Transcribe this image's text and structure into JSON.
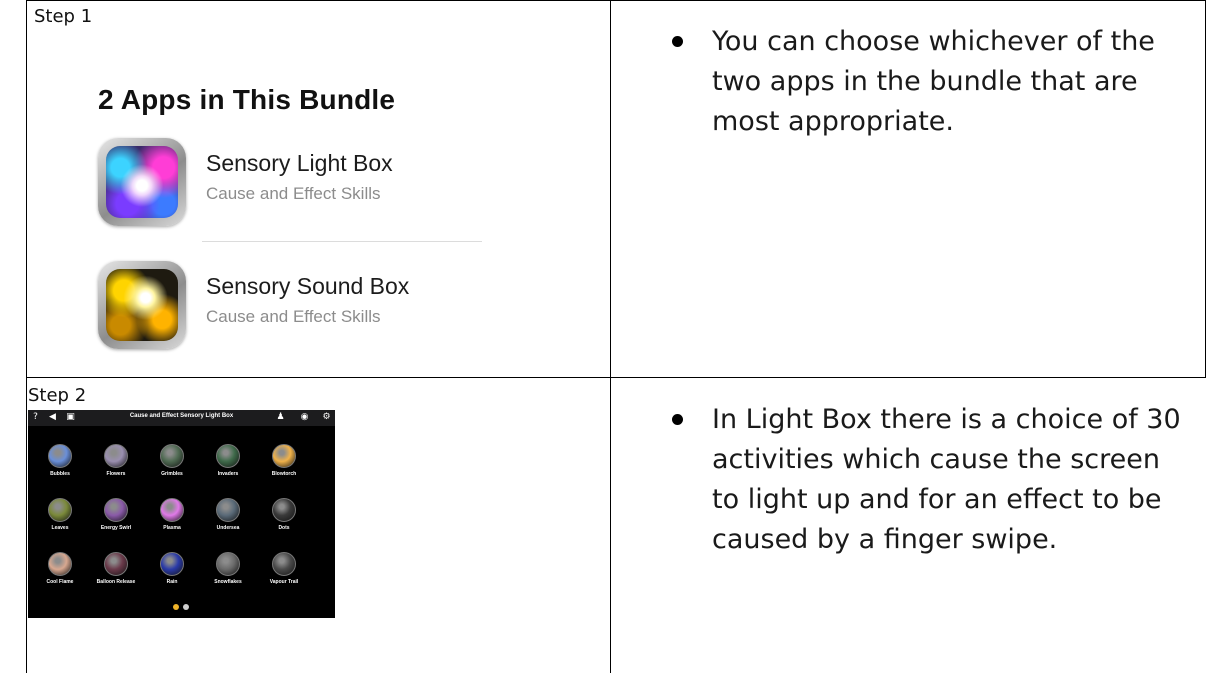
{
  "rows": [
    {
      "step": "Step 1",
      "bullet": "You can choose whichever of the two apps in the bundle that are most appropriate.",
      "bundle": {
        "title": "2 Apps in This Bundle",
        "apps": [
          {
            "name": "Sensory Light Box",
            "subtitle": "Cause and Effect Skills",
            "icon": "sensory-light-box-icon"
          },
          {
            "name": "Sensory Sound Box",
            "subtitle": "Cause and Effect Skills",
            "icon": "sensory-sound-box-icon"
          }
        ]
      }
    },
    {
      "step": "Step 2",
      "bullet": "In Light Box there is a choice of 30 activities which cause the screen to light up and for an effect to be caused by a finger swipe.",
      "screenshot": {
        "title": "Cause and Effect Sensory Light Box",
        "toolbar_icons": [
          "help-icon",
          "back-icon",
          "gallery-icon",
          "user-icon",
          "eye-icon",
          "gear-icon"
        ],
        "activities": [
          {
            "label": "Bubbles",
            "color": "#6a8fd8"
          },
          {
            "label": "Flowers",
            "color": "#9a8fb0"
          },
          {
            "label": "Grimbles",
            "color": "#4f6a52"
          },
          {
            "label": "Invaders",
            "color": "#3f6a4a"
          },
          {
            "label": "Blowtorch",
            "color": "#f0b24a"
          },
          {
            "label": "Leaves",
            "color": "#7b8a3a"
          },
          {
            "label": "Energy Swirl",
            "color": "#8a5aa8"
          },
          {
            "label": "Plasma",
            "color": "#e07ae8"
          },
          {
            "label": "Undersea",
            "color": "#5a6a78"
          },
          {
            "label": "Dots",
            "color": "#3a3a3a"
          },
          {
            "label": "Cool Flame",
            "color": "#d8a890"
          },
          {
            "label": "Balloon Release",
            "color": "#6a3a4a"
          },
          {
            "label": "Rain",
            "color": "#2a3aa8"
          },
          {
            "label": "Snowflakes",
            "color": "#6a6a6a"
          },
          {
            "label": "Vapour Trail",
            "color": "#4a4a4a"
          }
        ],
        "pager_colors": [
          "#f0b429",
          "#cfcfcf"
        ]
      }
    }
  ]
}
